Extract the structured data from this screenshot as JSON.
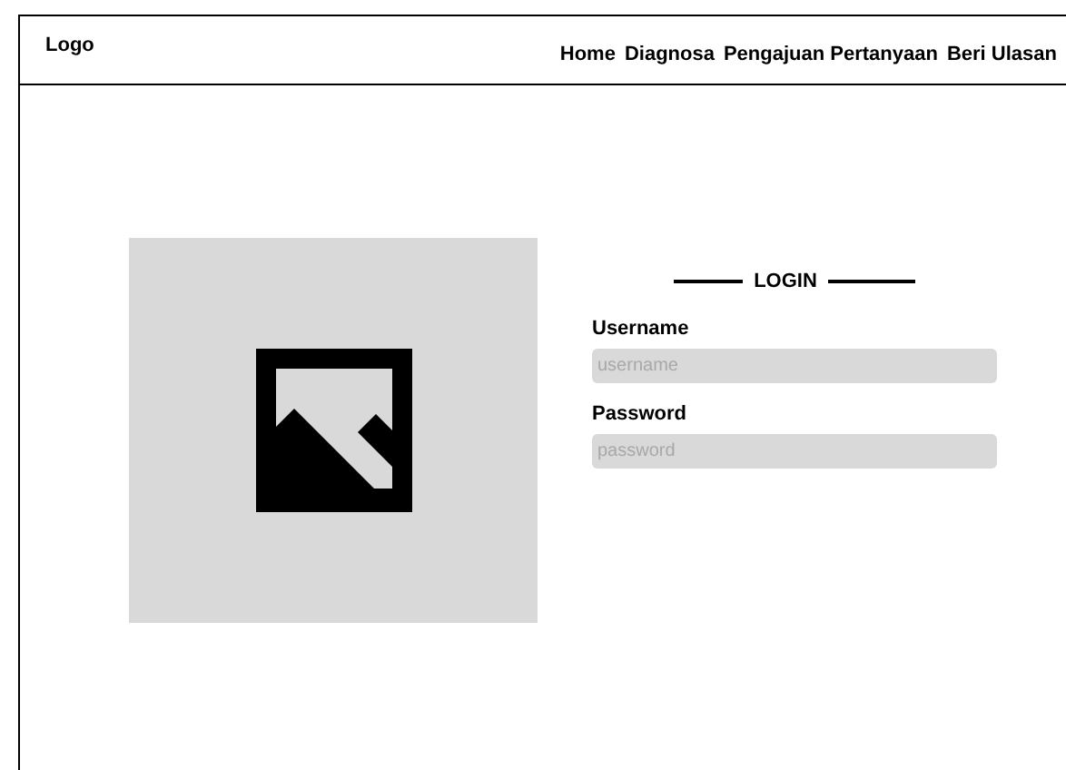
{
  "header": {
    "logo": "Logo",
    "nav": [
      {
        "label": "Home"
      },
      {
        "label": "Diagnosa"
      },
      {
        "label": "Pengajuan Pertanyaan"
      },
      {
        "label": "Beri Ulasan"
      }
    ]
  },
  "login": {
    "title": "LOGIN",
    "fields": [
      {
        "label": "Username",
        "placeholder": "username"
      },
      {
        "label": "Password",
        "placeholder": "password"
      }
    ]
  }
}
